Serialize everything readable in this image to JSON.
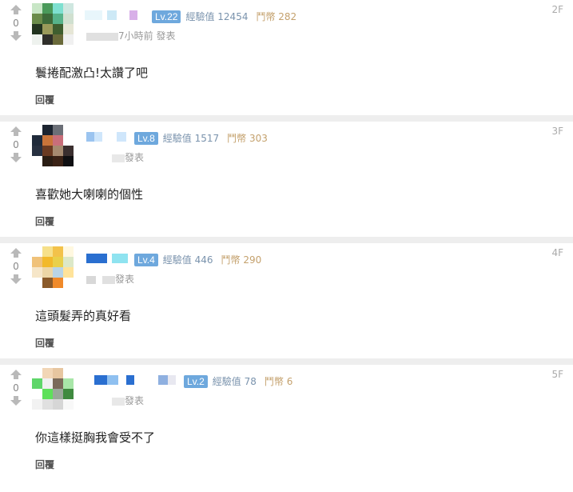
{
  "reply_label": "回覆",
  "comments": [
    {
      "floor": "2F",
      "votes": "0",
      "level": "Lv.22",
      "exp": "經驗值 12454",
      "coins": "鬥幣 282",
      "time": "7小時前 發表",
      "text": "鬟捲配激凸!太讚了吧",
      "avatar_colors": [
        "#c8e6c6",
        "#4a9a5a",
        "#7ee0d0",
        "#cfe7e0",
        "#6a8b4a",
        "#3e6b3a",
        "#57b38a",
        "#d0e0d0",
        "#22331f",
        "#9a9a5a",
        "#3f5e2f",
        "#e6e6d6",
        "#eef2ee",
        "#2f2f2a",
        "#6a6a3a",
        "#f0f0f0"
      ]
    },
    {
      "floor": "3F",
      "votes": "0",
      "level": "Lv.8",
      "exp": "經驗值 1517",
      "coins": "鬥幣 303",
      "time": "發表",
      "text": "喜歡她大喇喇的個性",
      "avatar_colors": [
        "#ffffff",
        "#1c2430",
        "#6b6f77",
        "#ffffff",
        "#1f2a3a",
        "#c9743a",
        "#c96e7a",
        "#ffffff",
        "#273040",
        "#6a3a22",
        "#a68a70",
        "#3a2f2f",
        "#ffffff",
        "#2a1d14",
        "#3a2216",
        "#0f0f12"
      ]
    },
    {
      "floor": "4F",
      "votes": "0",
      "level": "Lv.4",
      "exp": "經驗值 446",
      "coins": "鬥幣 290",
      "time": "發表",
      "text": "這頭髮弄的真好看",
      "avatar_colors": [
        "#ffffff",
        "#f6e08a",
        "#f3c24a",
        "#fff8e0",
        "#f0c27a",
        "#f2b92a",
        "#e9d04a",
        "#dce8c8",
        "#f6e6c8",
        "#ecd6a6",
        "#b9d4e6",
        "#ffe39a",
        "#ffffff",
        "#8a5a2a",
        "#f08a2a",
        "#ffffff"
      ]
    },
    {
      "floor": "5F",
      "votes": "0",
      "level": "Lv.2",
      "exp": "經驗值 78",
      "coins": "鬥幣 6",
      "time": "發表",
      "text": "你這樣挺胸我會受不了",
      "avatar_colors": [
        "#ffffff",
        "#f2d6b6",
        "#e7c6a0",
        "#ffffff",
        "#5fd66a",
        "#f0f0f0",
        "#7a6a5a",
        "#a8e6a8",
        "#ffffff",
        "#5ee05a",
        "#9aa89a",
        "#3f8a3f",
        "#f2f2f2",
        "#e0e0e0",
        "#d6d6d6",
        "#f8f8f8"
      ]
    }
  ]
}
